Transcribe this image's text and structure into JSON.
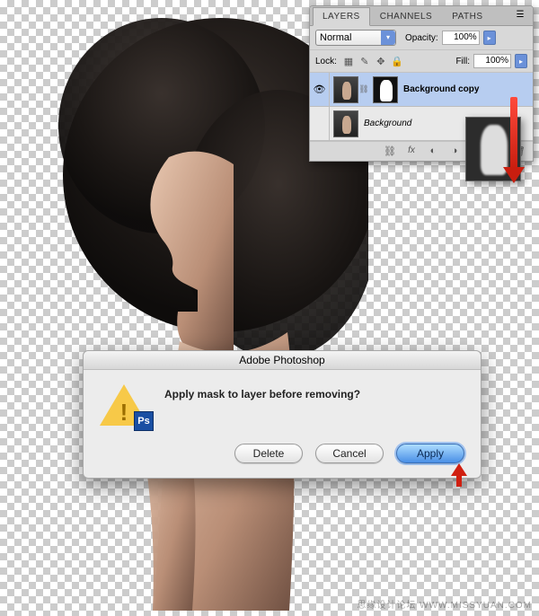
{
  "layers_panel": {
    "tabs": [
      "LAYERS",
      "CHANNELS",
      "PATHS"
    ],
    "active_tab": 0,
    "blend_mode": "Normal",
    "opacity_label": "Opacity:",
    "opacity_value": "100%",
    "lock_label": "Lock:",
    "fill_label": "Fill:",
    "fill_value": "100%",
    "layers": [
      {
        "name": "Background copy",
        "visible": true,
        "has_mask": true,
        "selected": true
      },
      {
        "name": "Background",
        "visible": false,
        "has_mask": false,
        "selected": false,
        "italic": true
      }
    ],
    "footer_icons": [
      "link",
      "fx",
      "mask",
      "adjust",
      "group",
      "new",
      "trash"
    ]
  },
  "dialog": {
    "title": "Adobe Photoshop",
    "message": "Apply mask to layer before removing?",
    "buttons": {
      "delete": "Delete",
      "cancel": "Cancel",
      "apply": "Apply"
    },
    "ps_badge": "Ps"
  },
  "watermark": "思缘设计论坛  WWW.MISSYUAN.COM"
}
